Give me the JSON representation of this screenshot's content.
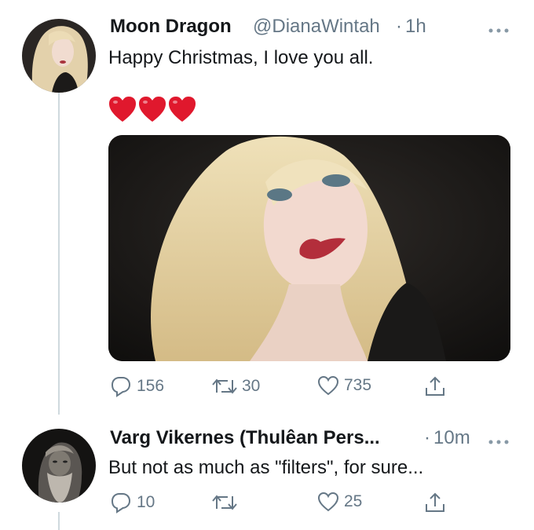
{
  "tweet1": {
    "display_name": "Moon Dragon",
    "handle": "@DianaWintah",
    "separator": "·",
    "time": "1h",
    "text": "Happy Christmas, I love you all.",
    "emoji": "❤️❤️❤️",
    "reply_count": "156",
    "retweet_count": "30",
    "like_count": "735"
  },
  "tweet2": {
    "display_name": "Varg Vikernes (Thulêan Pers...",
    "separator": "·",
    "time": "10m",
    "text": "But not as much as \"filters\", for sure...",
    "reply_count": "10",
    "retweet_count": "",
    "like_count": "25"
  },
  "icons": {
    "more": "more-horizontal-icon",
    "reply": "reply-icon",
    "retweet": "retweet-icon",
    "like": "heart-icon",
    "share": "share-icon"
  },
  "colors": {
    "text_primary": "#14171a",
    "text_secondary": "#657786",
    "thread_line": "#cfd9de",
    "heart_emoji": "#e0182d"
  }
}
